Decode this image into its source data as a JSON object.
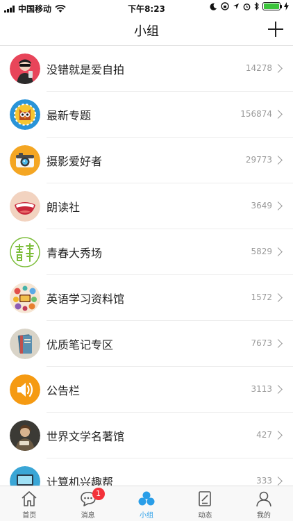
{
  "status_bar": {
    "carrier": "中国移动",
    "time": "下午8:23",
    "battery_level": 1.0
  },
  "header": {
    "title": "小组"
  },
  "groups": [
    {
      "name": "没错就是爱自拍",
      "count": "14278",
      "icon": "selfie-avatar-icon",
      "color": "#e8455a"
    },
    {
      "name": "最新专题",
      "count": "156874",
      "icon": "owl-topic-icon",
      "color": "#2a94d8"
    },
    {
      "name": "摄影爱好者",
      "count": "29773",
      "icon": "camera-icon",
      "color": "#f4a623"
    },
    {
      "name": "朗读社",
      "count": "3649",
      "icon": "mouth-icon",
      "color": "#f2d3c0"
    },
    {
      "name": "青春大秀场",
      "count": "5829",
      "icon": "youth-logo-icon",
      "color": "#ffffff"
    },
    {
      "name": "英语学习资料馆",
      "count": "1572",
      "icon": "book-collage-icon",
      "color": "#f6e6d4"
    },
    {
      "name": "优质笔记专区",
      "count": "7673",
      "icon": "notebook-icon",
      "color": "#d9d4c8"
    },
    {
      "name": "公告栏",
      "count": "3113",
      "icon": "speaker-icon",
      "color": "#f59a12"
    },
    {
      "name": "世界文学名著馆",
      "count": "427",
      "icon": "portrait-painting-icon",
      "color": "#3b3a35"
    },
    {
      "name": "计算机兴趣帮",
      "count": "333",
      "icon": "computer-icon",
      "color": "#3aa6d6"
    }
  ],
  "tabs": [
    {
      "label": "首页",
      "icon": "home-icon"
    },
    {
      "label": "消息",
      "icon": "message-icon",
      "badge": "1"
    },
    {
      "label": "小组",
      "icon": "group-icon",
      "active": true
    },
    {
      "label": "动态",
      "icon": "feed-icon"
    },
    {
      "label": "我的",
      "icon": "profile-icon"
    }
  ],
  "colors": {
    "accent": "#2a9ee8",
    "badge": "#f3313a",
    "count_text": "#999999"
  }
}
